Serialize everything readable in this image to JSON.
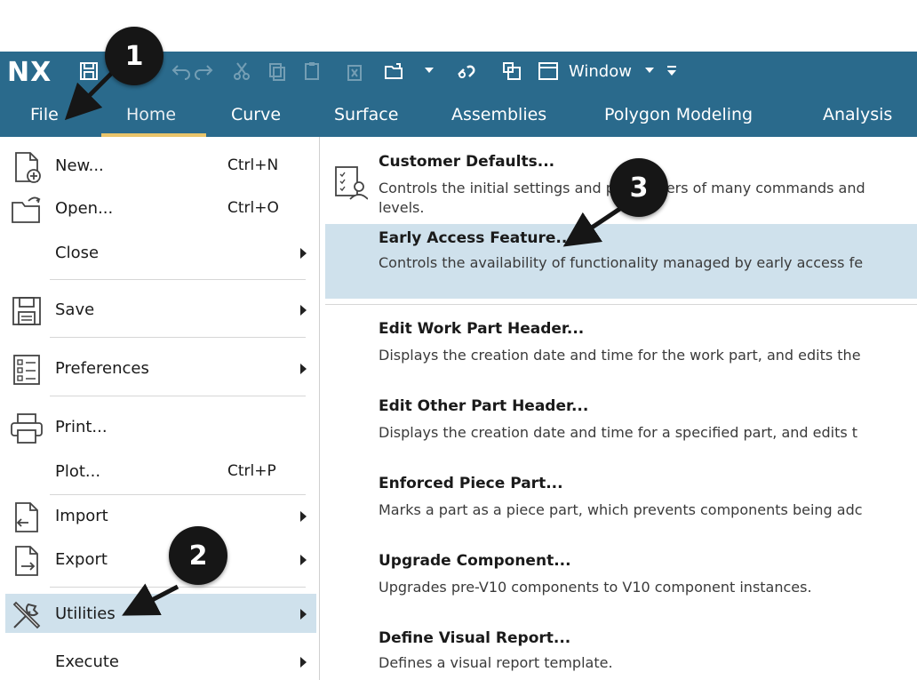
{
  "app": {
    "logo": "NX",
    "window_menu": "Window"
  },
  "tabs": [
    {
      "label": "File"
    },
    {
      "label": "Home"
    },
    {
      "label": "Curve"
    },
    {
      "label": "Surface"
    },
    {
      "label": "Assemblies"
    },
    {
      "label": "Polygon Modeling"
    },
    {
      "label": "Analysis"
    }
  ],
  "file_menu": {
    "new": {
      "label": "New...",
      "shortcut": "Ctrl+N",
      "icon": "new-document-icon"
    },
    "open": {
      "label": "Open...",
      "shortcut": "Ctrl+O",
      "icon": "open-folder-icon"
    },
    "close": {
      "label": "Close"
    },
    "save": {
      "label": "Save",
      "icon": "save-icon"
    },
    "preferences": {
      "label": "Preferences",
      "icon": "preferences-list-icon"
    },
    "print": {
      "label": "Print...",
      "icon": "printer-icon"
    },
    "plot": {
      "label": "Plot...",
      "shortcut": "Ctrl+P"
    },
    "import": {
      "label": "Import",
      "icon": "import-icon"
    },
    "export": {
      "label": "Export",
      "icon": "export-icon"
    },
    "utilities": {
      "label": "Utilities",
      "icon": "tools-icon"
    },
    "execute": {
      "label": "Execute"
    }
  },
  "utilities_submenu": [
    {
      "title": "Customer Defaults...",
      "desc": "Controls the initial settings and parameters of many commands and",
      "desc2": "levels."
    },
    {
      "title": "Early Access Feature...",
      "desc": "Controls the availability of functionality managed by early access fe"
    },
    {
      "title": "Edit Work Part Header...",
      "desc": "Displays the creation date and time for the work part, and edits the"
    },
    {
      "title": "Edit Other Part Header...",
      "desc": "Displays the creation date and time for a specified part, and edits t"
    },
    {
      "title": "Enforced Piece Part...",
      "desc": "Marks a part as a piece part, which prevents components being adc"
    },
    {
      "title": "Upgrade Component...",
      "desc": "Upgrades pre-V10 components to V10 component instances."
    },
    {
      "title": "Define Visual Report...",
      "desc": "Defines a visual report template."
    }
  ],
  "callouts": {
    "one": "1",
    "two": "2",
    "three": "3"
  },
  "colors": {
    "ribbon": "#2a6a8c",
    "highlight": "#cfe1ec",
    "home_underline": "#e9c46a"
  }
}
